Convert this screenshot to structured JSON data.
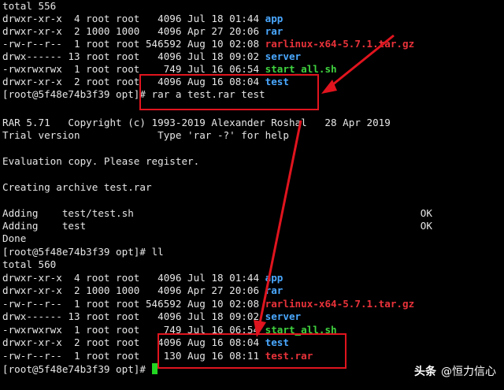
{
  "terminal": {
    "lines_a": {
      "total": "total 556",
      "app": {
        "meta": "drwxr-xr-x  4 root root   4096 Jul 18 01:44 ",
        "name": "app"
      },
      "rar": {
        "meta": "drwxr-xr-x  2 1000 1000   4096 Apr 27 20:06 ",
        "name": "rar"
      },
      "rarlinux": {
        "meta": "-rw-r--r--  1 root root 546592 Aug 10 02:08 ",
        "name": "rarlinux-x64-5.7.1.tar.gz"
      },
      "server": {
        "meta": "drwx------ 13 root root   4096 Jul 18 09:02 ",
        "name": "server"
      },
      "start": {
        "meta": "-rwxrwxrwx  1 root root    749 Jul 16 06:54 ",
        "name": "start_all.sh"
      },
      "test": {
        "meta": "drwxr-xr-x  2 root root   4096 Aug 16 08:04 ",
        "name": "test"
      }
    },
    "command1": "[root@5f48e74b3f39 opt]# rar a test.rar test",
    "banner1": "RAR 5.71   Copyright (c) 1993-2019 Alexander Roshal   28 Apr 2019",
    "banner2": "Trial version             Type 'rar -?' for help",
    "evaluation": "Evaluation copy. Please register.",
    "creating": "Creating archive test.rar",
    "adding1": "Adding    test/test.sh                                                OK",
    "adding2": "Adding    test                                                        OK",
    "done": "Done",
    "command2": "[root@5f48e74b3f39 opt]# ll",
    "lines_b": {
      "total": "total 560",
      "app": {
        "meta": "drwxr-xr-x  4 root root   4096 Jul 18 01:44 ",
        "name": "app"
      },
      "rar": {
        "meta": "drwxr-xr-x  2 1000 1000   4096 Apr 27 20:06 ",
        "name": "rar"
      },
      "rarlinux": {
        "meta": "-rw-r--r--  1 root root 546592 Aug 10 02:08 ",
        "name": "rarlinux-x64-5.7.1.tar.gz"
      },
      "server": {
        "meta": "drwx------ 13 root root   4096 Jul 18 09:02 ",
        "name": "server"
      },
      "start": {
        "meta": "-rwxrwxrwx  1 root root    749 Jul 16 06:54 ",
        "name": "start_all.sh"
      },
      "test": {
        "meta": "drwxr-xr-x  2 root root   4096 Aug 16 08:04 ",
        "name": "test"
      },
      "testrar": {
        "meta": "-rw-r--r--  1 root root    130 Aug 16 08:11 ",
        "name": "test.rar"
      }
    },
    "prompt_final": "[root@5f48e74b3f39 opt]# "
  },
  "colors": {
    "background": "#000000",
    "text": "#e6e6e6",
    "directory": "#4aa8ff",
    "archive": "#e8323a",
    "executable": "#3fd13f",
    "highlight": "#e0141e",
    "cursor": "#22d622"
  },
  "icons": {
    "logo": "toutiao-wordmark"
  },
  "watermark": {
    "logo_text": "头条",
    "handle": "@恒力信心"
  }
}
